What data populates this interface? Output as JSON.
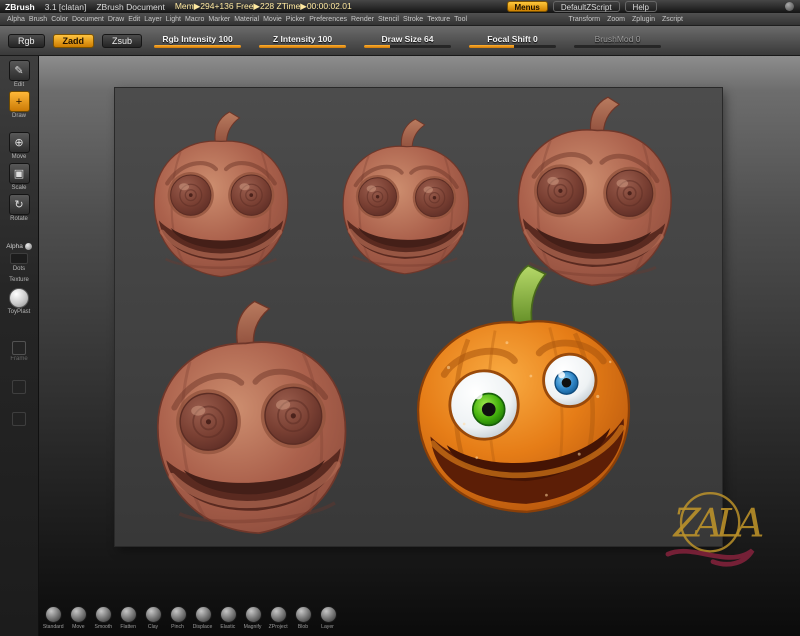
{
  "title_bar": {
    "app_name": "ZBrush",
    "version": "3.1 [clatan]",
    "document_name": "ZBrush Document",
    "stats": "Mem▶294+136 Free▶228 ZTime▶00:00:02.01",
    "menus_button": "Menus",
    "default_zscript_button": "DefaultZScript",
    "help_button": "Help"
  },
  "menu_bar": {
    "items": [
      "Alpha",
      "Brush",
      "Color",
      "Document",
      "Draw",
      "Edit",
      "Layer",
      "Light",
      "Macro",
      "Marker",
      "Material",
      "Movie",
      "Picker",
      "Preferences",
      "Render",
      "Stencil",
      "Stroke",
      "Texture",
      "Tool"
    ],
    "right_items": [
      "Transform",
      "Zoom",
      "Zplugin",
      "Zscript"
    ]
  },
  "toolbar": {
    "rgb_button": "Rgb",
    "zadd_button": "Zadd",
    "zsub_button": "Zsub",
    "sliders": [
      "Rgb Intensity 100",
      "Z Intensity 100",
      "Draw Size 64",
      "Focal Shift 0",
      "BrushMod 0"
    ]
  },
  "sidebar": {
    "tools": [
      "Edit",
      "Draw",
      "Move",
      "Scale",
      "Rotate"
    ],
    "alpha_label": "Alpha",
    "stroke_label": "Dots",
    "texture_label": "Texture",
    "material_label": "ToyPlast",
    "frame_label": "Frame"
  },
  "icons": {
    "edit": "✎",
    "draw": "+",
    "move": "⊕",
    "scale": "▣",
    "rotate": "↻"
  },
  "brushes": [
    "Standard",
    "Move",
    "Smooth",
    "Flatten",
    "Clay",
    "Pinch",
    "Displace",
    "Elastic",
    "Magnify",
    "ZProject",
    "Blob",
    "Layer"
  ],
  "watermark": {
    "text": "ZALA"
  },
  "colors": {
    "accent_orange": "#e89c20",
    "clay_material": "#a9614c",
    "pumpkin_orange": "#e67c18",
    "stem_green": "#86b23c",
    "iris_green": "#3fae10",
    "iris_blue": "#2f86c8"
  }
}
